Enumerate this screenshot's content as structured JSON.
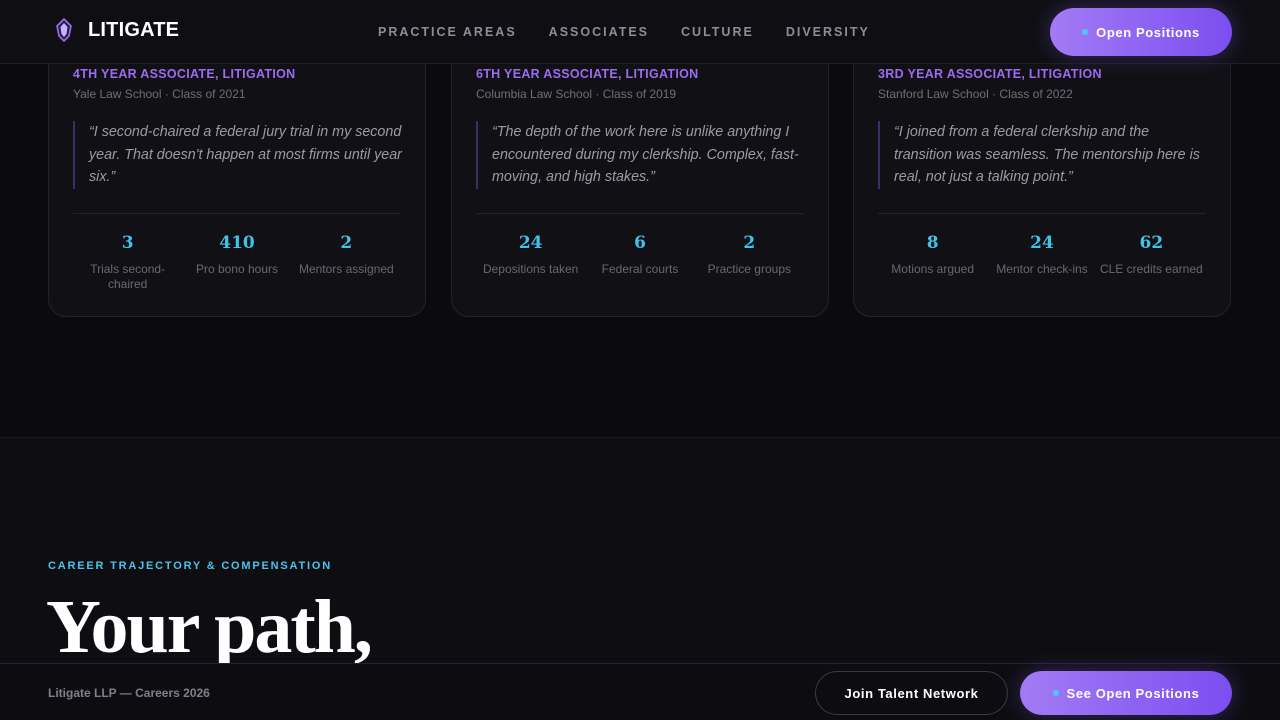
{
  "brand": {
    "name": "LITIGATE",
    "accent": "#9b6cf2",
    "highlight": "#41c2e8"
  },
  "nav": [
    "PRACTICE AREAS",
    "ASSOCIATES",
    "CULTURE",
    "DIVERSITY"
  ],
  "header": {
    "cta_label": "Open Positions"
  },
  "cards": [
    {
      "role": "4TH YEAR ASSOCIATE, LITIGATION",
      "school": "Yale Law School · Class of 2021",
      "quote": "“I second-chaired a federal jury trial in my second year. That doesn't happen at most firms until year six.”",
      "stats": [
        {
          "value": "3",
          "label": "Trials second-chaired"
        },
        {
          "value": "410",
          "label": "Pro bono hours"
        },
        {
          "value": "2",
          "label": "Mentors assigned"
        }
      ]
    },
    {
      "role": "6TH YEAR ASSOCIATE, LITIGATION",
      "school": "Columbia Law School · Class of 2019",
      "quote": "“The depth of the work here is unlike anything I encountered during my clerkship. Complex, fast-moving, and high stakes.”",
      "stats": [
        {
          "value": "24",
          "label": "Depositions taken"
        },
        {
          "value": "6",
          "label": "Federal courts"
        },
        {
          "value": "2",
          "label": "Practice groups"
        }
      ]
    },
    {
      "role": "3RD YEAR ASSOCIATE, LITIGATION",
      "school": "Stanford Law School · Class of 2022",
      "quote": "“I joined from a federal clerkship and the transition was seamless. The mentorship here is real, not just a talking point.”",
      "stats": [
        {
          "value": "8",
          "label": "Motions argued"
        },
        {
          "value": "24",
          "label": "Mentor check-ins"
        },
        {
          "value": "62",
          "label": "CLE credits earned"
        }
      ]
    }
  ],
  "section": {
    "eyebrow": "CAREER TRAJECTORY & COMPENSATION",
    "title": "Your path,"
  },
  "footer": {
    "copy": "Litigate LLP — Careers 2026",
    "ghost_label": "Join Talent Network",
    "cta_label": "See Open Positions"
  }
}
